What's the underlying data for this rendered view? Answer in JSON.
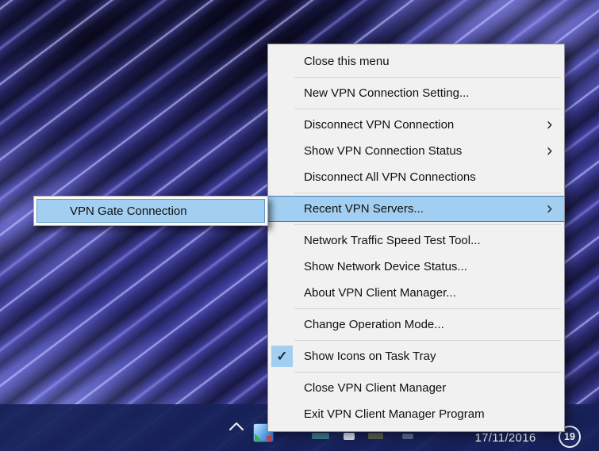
{
  "menu": {
    "items": [
      {
        "label": "Close this menu"
      },
      {
        "label": "New VPN Connection Setting..."
      },
      {
        "label": "Disconnect VPN Connection",
        "has_submenu": true
      },
      {
        "label": "Show VPN Connection Status",
        "has_submenu": true
      },
      {
        "label": "Disconnect All VPN Connections"
      },
      {
        "label": "Recent VPN Servers...",
        "has_submenu": true,
        "highlighted": true
      },
      {
        "label": "Network Traffic Speed Test Tool..."
      },
      {
        "label": "Show Network Device Status..."
      },
      {
        "label": "About VPN Client Manager..."
      },
      {
        "label": "Change Operation Mode..."
      },
      {
        "label": "Show Icons on Task Tray",
        "checked": true
      },
      {
        "label": "Close VPN Client Manager"
      },
      {
        "label": "Exit VPN Client Manager Program"
      }
    ]
  },
  "submenu": {
    "items": [
      {
        "label": "VPN Gate Connection",
        "highlighted": true
      }
    ]
  },
  "taskbar": {
    "date": "17/11/2016",
    "notification_count": "19"
  },
  "icons": {
    "submenu_arrow": "›",
    "checkmark": "✓"
  },
  "colors": {
    "menu_background": "#f1f1f1",
    "highlight": "#a2cff1",
    "highlight_border": "#4b7ca8",
    "taskbar": "#172158",
    "menu_text": "#101010"
  }
}
